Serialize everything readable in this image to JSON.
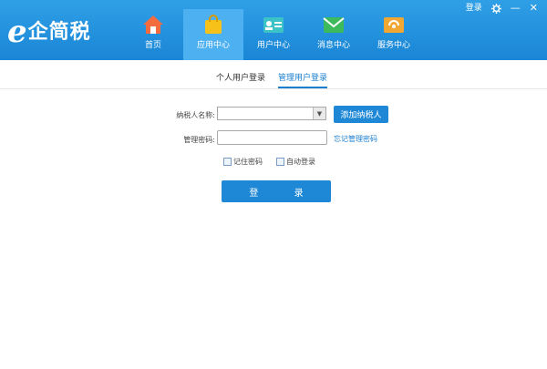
{
  "app": {
    "logo_mark": "e",
    "logo_text": "企简税"
  },
  "topbar": {
    "login_label": "登录",
    "settings_icon": "gear-icon",
    "minimize_label": "—",
    "close_label": "✕"
  },
  "nav": [
    {
      "label": "首页",
      "icon": "home-icon",
      "active": false
    },
    {
      "label": "应用中心",
      "icon": "shopping-bag-icon",
      "active": true
    },
    {
      "label": "用户中心",
      "icon": "id-card-icon",
      "active": false
    },
    {
      "label": "消息中心",
      "icon": "envelope-icon",
      "active": false
    },
    {
      "label": "服务中心",
      "icon": "service-icon",
      "active": false
    }
  ],
  "tabs": [
    {
      "label": "个人用户登录",
      "active": false
    },
    {
      "label": "管理用户登录",
      "active": true
    }
  ],
  "form": {
    "taxpayer_label": "纳税人名称:",
    "taxpayer_value": "",
    "add_taxpayer_button": "添加纳税人",
    "password_label": "管理密码:",
    "password_value": "",
    "forgot_password_link": "忘记管理密码",
    "remember_password_label": "记住密码",
    "auto_login_label": "自动登录",
    "login_button": "登 录"
  },
  "colors": {
    "header_blue": "#1a86d6",
    "button_blue": "#1e88d6",
    "link_blue": "#1b7fd0"
  }
}
